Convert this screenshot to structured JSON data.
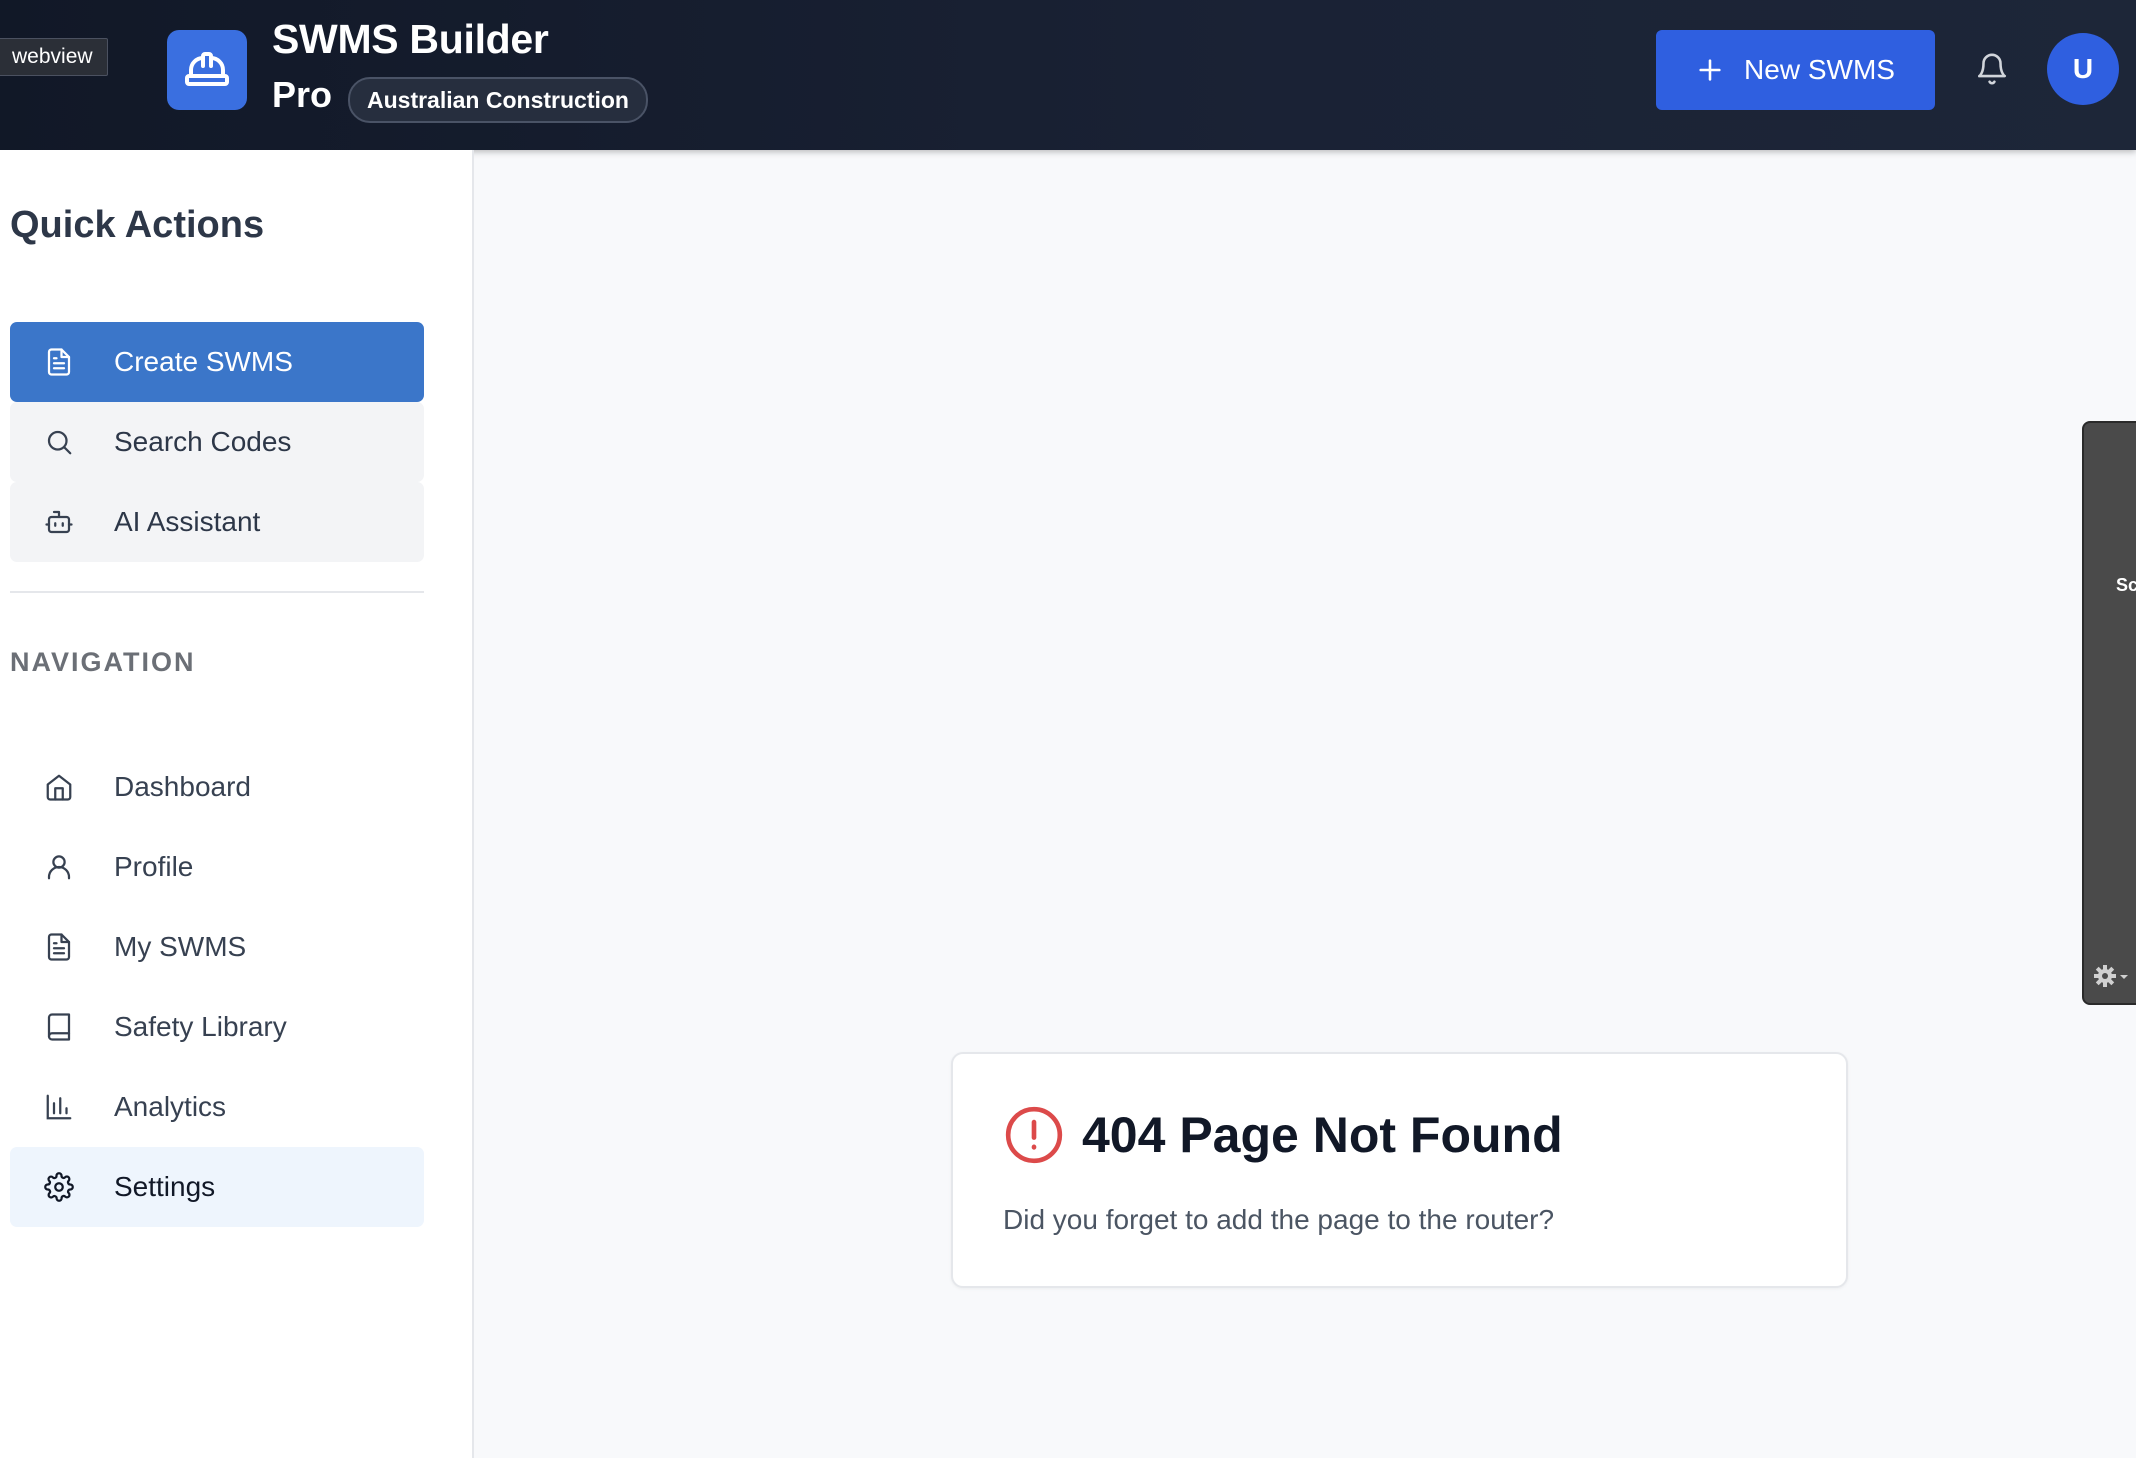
{
  "window": {
    "tag": "webview"
  },
  "header": {
    "title": "SWMS Builder",
    "subtitle": "Pro",
    "badge": "Australian Construction",
    "new_button_label": "New SWMS",
    "avatar_initial": "U",
    "logo_icon": "hard-hat-icon",
    "notification_icon": "bell-icon"
  },
  "sidebar": {
    "quick_actions_heading": "Quick Actions",
    "quick_actions": [
      {
        "label": "Create SWMS",
        "icon": "file-text-icon",
        "active": true
      },
      {
        "label": "Search Codes",
        "icon": "search-icon",
        "active": false
      },
      {
        "label": "AI Assistant",
        "icon": "bot-icon",
        "active": false
      }
    ],
    "navigation_heading": "NAVIGATION",
    "navigation": [
      {
        "label": "Dashboard",
        "icon": "home-icon"
      },
      {
        "label": "Profile",
        "icon": "user-icon"
      },
      {
        "label": "My SWMS",
        "icon": "file-text-icon"
      },
      {
        "label": "Safety Library",
        "icon": "book-icon"
      },
      {
        "label": "Analytics",
        "icon": "bar-chart-icon"
      },
      {
        "label": "Settings",
        "icon": "gear-icon",
        "current": true
      }
    ]
  },
  "main": {
    "error_title": "404 Page Not Found",
    "error_message": "Did you forget to add the page to the router?",
    "error_icon": "alert-circle-icon"
  },
  "side_panel": {
    "label": "Sc",
    "icon": "gear-dropdown-icon"
  },
  "colors": {
    "header_bg": "#111827",
    "accent": "#2f5fe0",
    "active_item": "#3b76c9",
    "current_nav_bg": "#eef5fd",
    "error_red": "#dc4a4a",
    "page_bg": "#f8f9fb"
  }
}
